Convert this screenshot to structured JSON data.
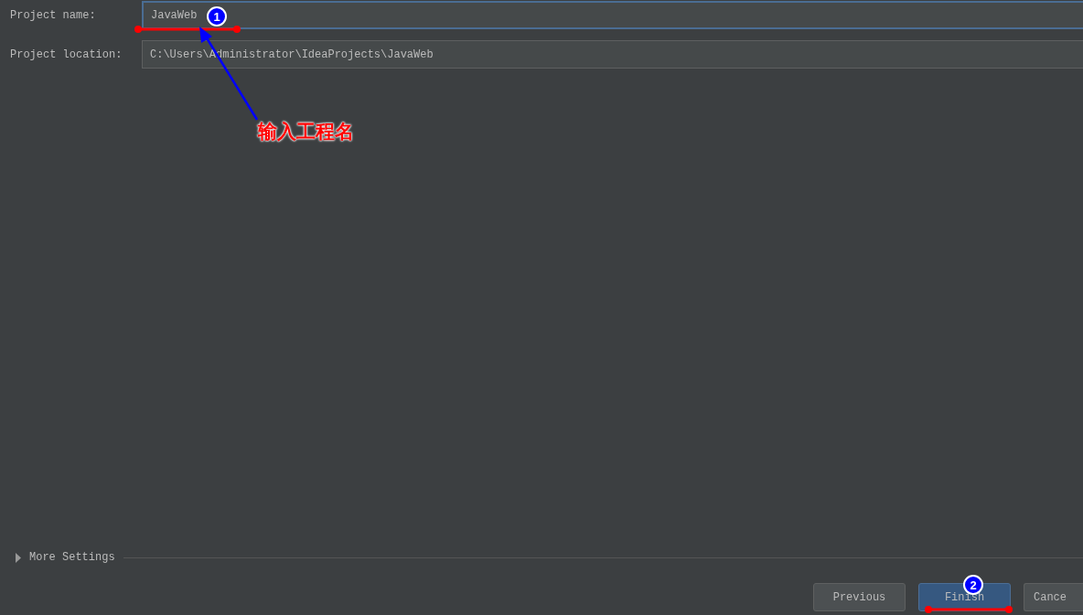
{
  "fields": [
    {
      "label": "Project name:",
      "value": "JavaWeb",
      "focused": true
    },
    {
      "label": "Project location:",
      "value": "C:\\Users\\Administrator\\IdeaProjects\\JavaWeb",
      "focused": false
    }
  ],
  "more_settings": {
    "label": "More Settings",
    "expanded": false
  },
  "buttons": [
    {
      "label": "Previous",
      "default": false
    },
    {
      "label": "Finish",
      "default": true
    },
    {
      "label": "Cance",
      "default": false
    }
  ],
  "annotations": {
    "note": "输入工程名",
    "markers": [
      "1",
      "2"
    ]
  }
}
